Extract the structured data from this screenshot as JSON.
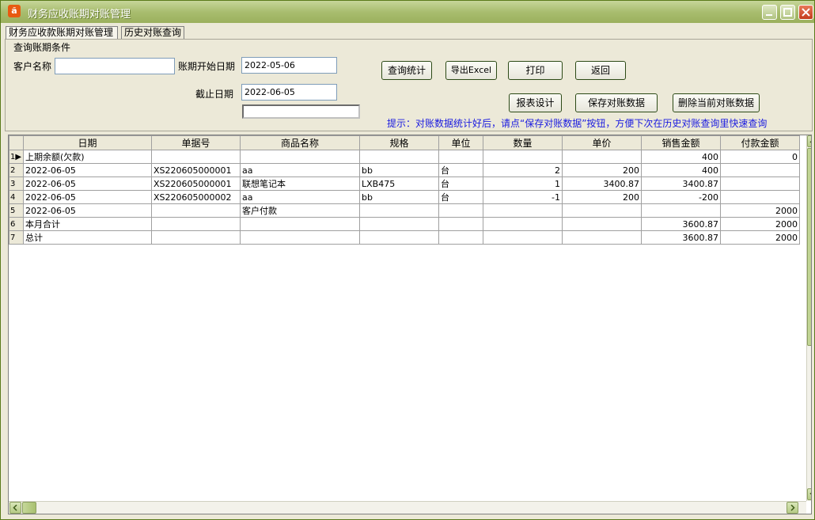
{
  "window": {
    "title": "财务应收账期对账管理"
  },
  "tabs": [
    {
      "label": "财务应收款账期对账管理"
    },
    {
      "label": "历史对账查询"
    }
  ],
  "query": {
    "group_label": "查询账期条件",
    "customer_label": "客户名称",
    "customer_value": "",
    "start_label": "账期开始日期",
    "start_value": "2022-05-06",
    "end_label": "截止日期",
    "end_value": "2022-06-05",
    "extra_value": ""
  },
  "buttons": {
    "query": "查询统计",
    "export": "导出Excel",
    "print": "打印",
    "back": "返回",
    "report": "报表设计",
    "save": "保存对账数据",
    "delete": "删除当前对账数据"
  },
  "hint": "提示：对账数据统计好后，请点“保存对账数据”按钮，方便下次在历史对账查询里快速查询",
  "grid": {
    "columns": [
      "日期",
      "单据号",
      "商品名称",
      "规格",
      "单位",
      "数量",
      "单价",
      "销售金额",
      "付款金额"
    ],
    "rows": [
      [
        "上期余额(欠款)",
        "",
        "",
        "",
        "",
        "",
        "",
        "400",
        "0"
      ],
      [
        "2022-06-05",
        "XS220605000001",
        "aa",
        "bb",
        "台",
        "2",
        "200",
        "400",
        ""
      ],
      [
        "2022-06-05",
        "XS220605000001",
        "联想笔记本",
        "LXB475",
        "台",
        "1",
        "3400.87",
        "3400.87",
        ""
      ],
      [
        "2022-06-05",
        "XS220605000002",
        "aa",
        "bb",
        "台",
        "-1",
        "200",
        "-200",
        ""
      ],
      [
        "2022-06-05",
        "",
        "客户付款",
        "",
        "",
        "",
        "",
        "",
        "2000"
      ],
      [
        "本月合计",
        "",
        "",
        "",
        "",
        "",
        "",
        "3600.87",
        "2000"
      ],
      [
        "总计",
        "",
        "",
        "",
        "",
        "",
        "",
        "3600.87",
        "2000"
      ]
    ],
    "row_numbers": [
      "1",
      "2",
      "3",
      "4",
      "5",
      "6",
      "7"
    ]
  }
}
